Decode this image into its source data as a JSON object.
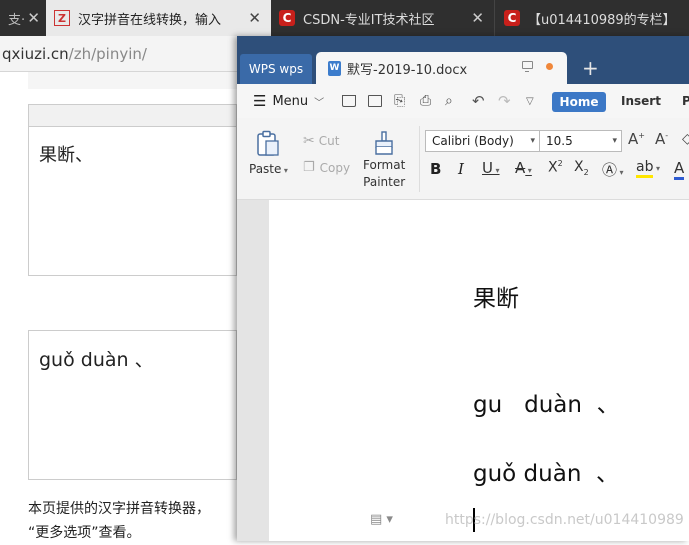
{
  "browser": {
    "tabs": [
      {
        "label": "支·",
        "active": false
      },
      {
        "label": "汉字拼音在线转换，输入",
        "active": true
      },
      {
        "label": "CSDN-专业IT技术社区",
        "active": false
      },
      {
        "label": "【u014410989的专栏】",
        "active": false
      }
    ],
    "url_host": "qxiuzi.cn",
    "url_path": "/zh/pinyin/"
  },
  "page": {
    "input_text": "果断、",
    "output_pinyin": "guǒ duàn 、",
    "description_line1": "本页提供的汉字拼音转换器，",
    "description_line2": "“更多选项”查看。"
  },
  "wps": {
    "logo_label": "WPS wps",
    "doc_tab_label": "默写-2019-10.docx",
    "menu_label": "Menu",
    "tab_home": "Home",
    "tab_insert": "Insert",
    "tab_more": "P",
    "paste_label": "Paste",
    "cut_label": "Cut",
    "copy_label": "Copy",
    "format_painter_line1": "Format",
    "format_painter_line2": "Painter",
    "font_name": "Calibri (Body)",
    "font_size": "10.5",
    "doc_lines": [
      "果断",
      "gu   duàn  、",
      "guǒ duàn  、"
    ]
  },
  "watermark": "https://blog.csdn.net/u014410989"
}
